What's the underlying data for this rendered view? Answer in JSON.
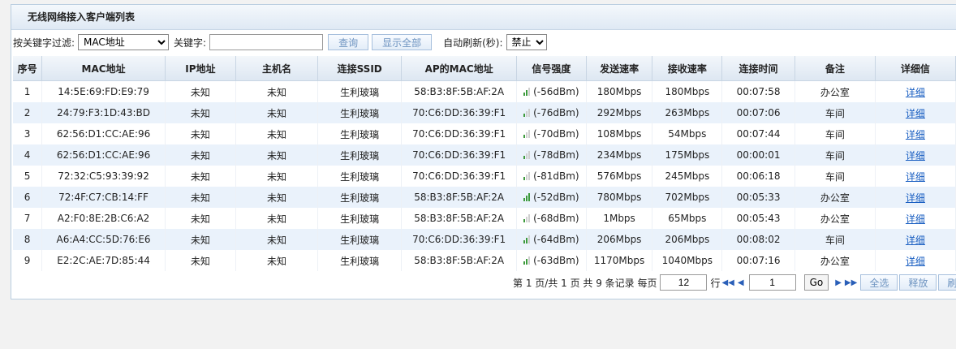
{
  "panel": {
    "title": "无线网络接入客户端列表"
  },
  "filter": {
    "filter_label": "按关键字过滤:",
    "filter_field_value": "MAC地址",
    "keyword_label": "关键字:",
    "keyword_value": "",
    "search_button": "查询",
    "show_all_button": "显示全部",
    "auto_refresh_label": "自动刷新(秒):",
    "auto_refresh_value": "禁止"
  },
  "table": {
    "headers": [
      "序号",
      "MAC地址",
      "IP地址",
      "主机名",
      "连接SSID",
      "AP的MAC地址",
      "信号强度",
      "发送速率",
      "接收速率",
      "连接时间",
      "备注",
      "详细信"
    ],
    "rows": [
      {
        "no": "1",
        "mac": "14:5E:69:FD:E9:79",
        "ip": "未知",
        "host": "未知",
        "ssid": "生利玻璃",
        "ap_mac": "58:B3:8F:5B:AF:2A",
        "signal": "(-56dBm)",
        "signal_bars": 2,
        "tx": "180Mbps",
        "rx": "180Mbps",
        "time": "00:07:58",
        "note": "办公室",
        "detail": "详细"
      },
      {
        "no": "2",
        "mac": "24:79:F3:1D:43:BD",
        "ip": "未知",
        "host": "未知",
        "ssid": "生利玻璃",
        "ap_mac": "70:C6:DD:36:39:F1",
        "signal": "(-76dBm)",
        "signal_bars": 1,
        "tx": "292Mbps",
        "rx": "263Mbps",
        "time": "00:07:06",
        "note": "车间",
        "detail": "详细"
      },
      {
        "no": "3",
        "mac": "62:56:D1:CC:AE:96",
        "ip": "未知",
        "host": "未知",
        "ssid": "生利玻璃",
        "ap_mac": "70:C6:DD:36:39:F1",
        "signal": "(-70dBm)",
        "signal_bars": 1,
        "tx": "108Mbps",
        "rx": "54Mbps",
        "time": "00:07:44",
        "note": "车间",
        "detail": "详细"
      },
      {
        "no": "4",
        "mac": "62:56:D1:CC:AE:96",
        "ip": "未知",
        "host": "未知",
        "ssid": "生利玻璃",
        "ap_mac": "70:C6:DD:36:39:F1",
        "signal": "(-78dBm)",
        "signal_bars": 1,
        "tx": "234Mbps",
        "rx": "175Mbps",
        "time": "00:00:01",
        "note": "车间",
        "detail": "详细"
      },
      {
        "no": "5",
        "mac": "72:32:C5:93:39:92",
        "ip": "未知",
        "host": "未知",
        "ssid": "生利玻璃",
        "ap_mac": "70:C6:DD:36:39:F1",
        "signal": "(-81dBm)",
        "signal_bars": 1,
        "tx": "576Mbps",
        "rx": "245Mbps",
        "time": "00:06:18",
        "note": "车间",
        "detail": "详细"
      },
      {
        "no": "6",
        "mac": "72:4F:C7:CB:14:FF",
        "ip": "未知",
        "host": "未知",
        "ssid": "生利玻璃",
        "ap_mac": "58:B3:8F:5B:AF:2A",
        "signal": "(-52dBm)",
        "signal_bars": 3,
        "tx": "780Mbps",
        "rx": "702Mbps",
        "time": "00:05:33",
        "note": "办公室",
        "detail": "详细"
      },
      {
        "no": "7",
        "mac": "A2:F0:8E:2B:C6:A2",
        "ip": "未知",
        "host": "未知",
        "ssid": "生利玻璃",
        "ap_mac": "58:B3:8F:5B:AF:2A",
        "signal": "(-68dBm)",
        "signal_bars": 1,
        "tx": "1Mbps",
        "rx": "65Mbps",
        "time": "00:05:43",
        "note": "办公室",
        "detail": "详细"
      },
      {
        "no": "8",
        "mac": "A6:A4:CC:5D:76:E6",
        "ip": "未知",
        "host": "未知",
        "ssid": "生利玻璃",
        "ap_mac": "70:C6:DD:36:39:F1",
        "signal": "(-64dBm)",
        "signal_bars": 2,
        "tx": "206Mbps",
        "rx": "206Mbps",
        "time": "00:08:02",
        "note": "车间",
        "detail": "详细"
      },
      {
        "no": "9",
        "mac": "E2:2C:AE:7D:85:44",
        "ip": "未知",
        "host": "未知",
        "ssid": "生利玻璃",
        "ap_mac": "58:B3:8F:5B:AF:2A",
        "signal": "(-63dBm)",
        "signal_bars": 2,
        "tx": "1170Mbps",
        "rx": "1040Mbps",
        "time": "00:07:16",
        "note": "办公室",
        "detail": "详细"
      }
    ]
  },
  "pager": {
    "summary": "第 1 页/共 1 页 共 9 条记录 每页",
    "page_size": "12",
    "row_unit": "行",
    "first_icon": "first-page-icon",
    "prev_icon": "prev-page-icon",
    "page_input": "1",
    "go_button": "Go",
    "next_icon": "next-page-icon",
    "last_icon": "last-page-icon",
    "select_all_button": "全选",
    "release_button": "释放",
    "extra_button": "刷"
  },
  "colors": {
    "header_bg": "#dde7f2",
    "row_alt_bg": "#eaf2fb",
    "signal_green": "#3c9a3c",
    "link": "#1a5fc2"
  }
}
